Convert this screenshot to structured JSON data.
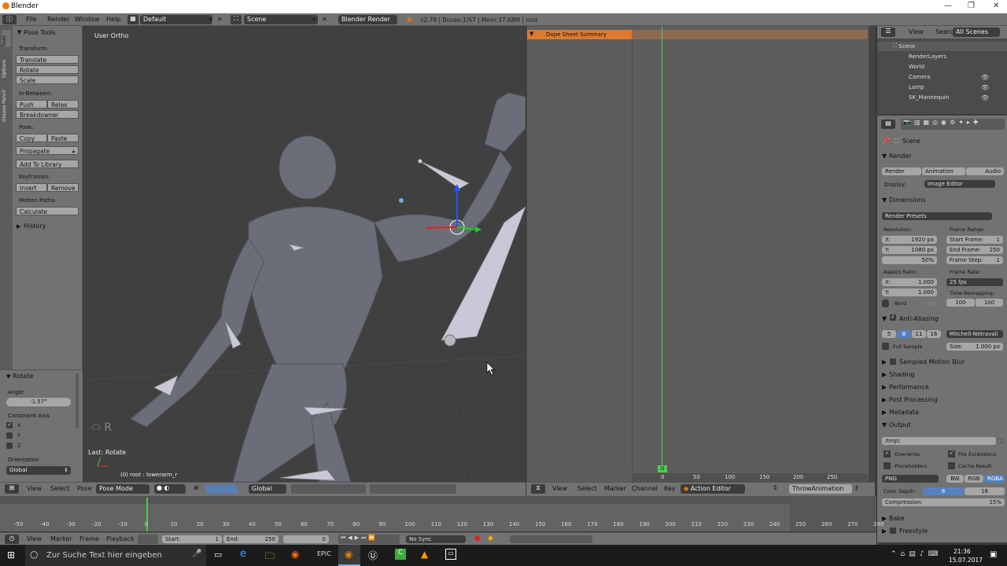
{
  "window": {
    "title": "Blender"
  },
  "info_bar": {
    "menus": [
      "File",
      "Render",
      "Window",
      "Help"
    ],
    "layout": "Default",
    "scene": "Scene",
    "engine": "Blender Render",
    "stats": "v2.78 | Bones:1/67 | Mem:37.68M | root"
  },
  "toolshelf": {
    "tabs": [
      "Tools",
      "Options",
      "Grease Pencil"
    ],
    "title": "Pose Tools",
    "transform_label": "Transform:",
    "translate": "Translate",
    "rotate": "Rotate",
    "scale": "Scale",
    "inbetween_label": "In-Between:",
    "push": "Push",
    "relax": "Relax",
    "breakdowner": "Breakdowner",
    "pose_label": "Pose:",
    "copy": "Copy",
    "paste": "Paste",
    "propagate": "Propagate",
    "add_to_library": "Add To Library",
    "keyframes_label": "Keyframes:",
    "insert": "Insert",
    "remove": "Remove",
    "motion_paths_label": "Motion Paths:",
    "calculate": "Calculate",
    "history": "History"
  },
  "redo_panel": {
    "title": "Rotate",
    "angle_label": "Angle",
    "angle_value": "-1.57°",
    "constraint_axis_label": "Constraint Axis",
    "axes": [
      "X",
      "Y",
      "Z"
    ],
    "axis_checked": [
      true,
      false,
      false
    ],
    "orientation_label": "Orientation",
    "orientation_value": "Global"
  },
  "viewport": {
    "view_name": "User Ortho",
    "key_hint": "R",
    "last_op": "Last: Rotate",
    "object_info": "(0) root : lowerarm_r",
    "header": {
      "menus": [
        "View",
        "Select",
        "Pose"
      ],
      "mode": "Pose Mode",
      "orientation": "Global"
    }
  },
  "dopesheet": {
    "summary": "Dope Sheet Summary",
    "frame_indicator": "0",
    "ruler": [
      "0",
      "50",
      "100",
      "150",
      "200",
      "250"
    ],
    "header": {
      "menus": [
        "View",
        "Select",
        "Marker",
        "Channel",
        "Key"
      ],
      "mode": "Action Editor",
      "action": "ThrowAnimation",
      "fake_user": "F"
    }
  },
  "outliner": {
    "menus": [
      "View",
      "Search"
    ],
    "filter": "All Scenes",
    "items": [
      "Scene",
      "RenderLayers",
      "World",
      "Camera",
      "Lamp",
      "SK_Mannequin"
    ]
  },
  "properties": {
    "breadcrumb": "Scene",
    "render_section": "Render",
    "render_btn": "Render",
    "animation_btn": "Animation",
    "audio_btn": "Audio",
    "display_label": "Display:",
    "display_value": "Image Editor",
    "dimensions_section": "Dimensions",
    "render_presets": "Render Presets",
    "resolution_label": "Resolution:",
    "res_x": "X:",
    "res_x_val": "1920 px",
    "res_y": "Y:",
    "res_y_val": "1080 px",
    "res_pct": "50%",
    "frame_range_label": "Frame Range:",
    "start_frame": "Start Frame:",
    "start_val": "1",
    "end_frame": "End Frame:",
    "end_val": "250",
    "frame_step": "Frame Step:",
    "step_val": "1",
    "aspect_label": "Aspect Ratio:",
    "asp_x": "X:",
    "asp_x_val": "1.000",
    "asp_y": "Y:",
    "asp_y_val": "1.000",
    "frame_rate_label": "Frame Rate:",
    "frame_rate": "25 fps",
    "time_remap_label": "Time Remapping:",
    "remap_old": "100",
    "remap_new": "100",
    "bord": "Bord",
    "crop": "Crop",
    "aa_section": "Anti-Aliasing",
    "aa_samples": [
      "5",
      "8",
      "11",
      "16"
    ],
    "aa_filter": "Mitchell-Netravali",
    "full_sample": "Full Sample",
    "size": "Size:",
    "size_val": "1.000 px",
    "sampled_motion_blur": "Sampled Motion Blur",
    "shading": "Shading",
    "performance": "Performance",
    "post_processing": "Post Processing",
    "metadata": "Metadata",
    "output": "Output",
    "output_path": "/tmp\\",
    "overwrite": "Overwrite",
    "file_extensions": "File Extensions",
    "placeholders": "Placeholders",
    "cache_result": "Cache Result",
    "format": "PNG",
    "bw": "BW",
    "rgb": "RGB",
    "rgba": "RGBA",
    "color_depth": "Color Depth:",
    "depth_8": "8",
    "depth_16": "16",
    "compression": "Compression:",
    "compression_val": "15%",
    "bake": "Bake",
    "freestyle": "Freestyle"
  },
  "timeline": {
    "ticks": [
      "-50",
      "-40",
      "-30",
      "-20",
      "-10",
      "0",
      "10",
      "20",
      "30",
      "40",
      "50",
      "60",
      "70",
      "80",
      "90",
      "100",
      "110",
      "120",
      "130",
      "140",
      "150",
      "160",
      "170",
      "180",
      "190",
      "200",
      "210",
      "220",
      "230",
      "240",
      "250",
      "260",
      "270",
      "280"
    ],
    "menus": [
      "View",
      "Marker",
      "Frame",
      "Playback"
    ],
    "start": "Start:",
    "start_val": "1",
    "end": "End:",
    "end_val": "250",
    "current": "0",
    "sync": "No Sync"
  },
  "taskbar": {
    "search_placeholder": "Zur Suche Text hier eingeben",
    "time": "21:36",
    "date": "15.07.2017"
  }
}
